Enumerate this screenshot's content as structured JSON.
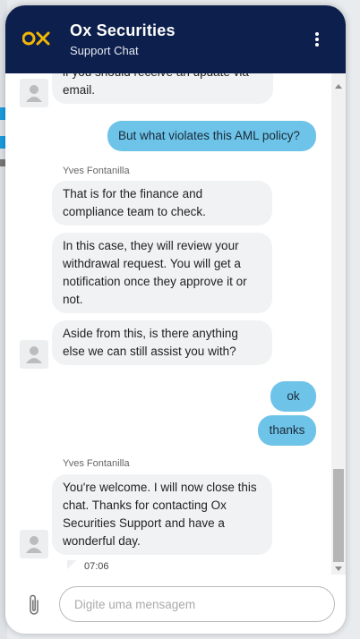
{
  "header": {
    "title": "Ox Securities",
    "subtitle": "Support Chat",
    "logo_text": "OX"
  },
  "colors": {
    "header_bg": "#0d1f4c",
    "outgoing_bubble": "#6ec3e8",
    "incoming_bubble": "#f1f2f4",
    "logo_gold": "#f2b705"
  },
  "icons": {
    "menu": "kebab-menu-icon",
    "avatar": "user-avatar-icon",
    "attach": "paperclip-icon"
  },
  "messages": {
    "m1_text": "if you should receive an update via email.",
    "m2_text": "But what violates this AML policy?",
    "sender1": "Yves Fontanilla",
    "m3_text": "That is for the finance and compliance team to check.",
    "m4_text": "In this case, they will review your withdrawal request. You will get a notification once they approve it or not.",
    "m5_text": "Aside from this, is there anything else we can still assist you with?",
    "m6_text": "ok",
    "m7_text": "thanks",
    "sender2": "Yves Fontanilla",
    "m8_text": "You're welcome. I will now close this chat. Thanks for contacting Ox Securities Support and have a wonderful day.",
    "time": "07:06"
  },
  "composer": {
    "placeholder": "Digite uma mensagem"
  }
}
